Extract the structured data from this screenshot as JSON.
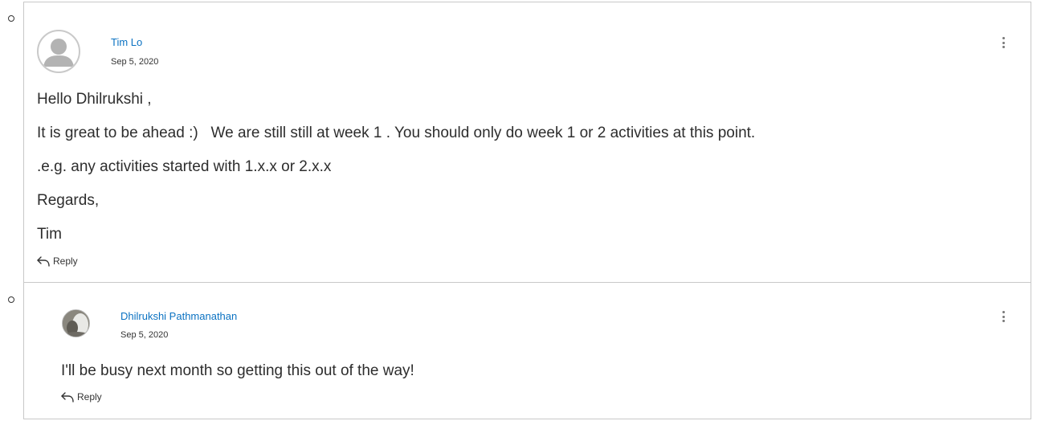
{
  "thread": [
    {
      "author": "Tim Lo",
      "date": "Sep 5, 2020",
      "avatar_icon": "default-user-avatar-icon",
      "paragraphs": [
        "Hello Dhilrukshi ,",
        "It is great to be ahead :)   We are still still at week 1 . You should only do week 1 or 2 activities at this point.",
        ".e.g. any activities started with 1.x.x or 2.x.x",
        "Regards,",
        "Tim"
      ],
      "reply_label": "Reply"
    },
    {
      "author": "Dhilrukshi Pathmanathan",
      "date": "Sep 5, 2020",
      "avatar_icon": "user-photo-avatar",
      "paragraphs": [
        "I'll be busy next month so getting this out of the way!"
      ],
      "reply_label": "Reply"
    }
  ],
  "colors": {
    "link": "#0b72c2",
    "border": "#c8c8c8",
    "text": "#2d2d2d"
  }
}
